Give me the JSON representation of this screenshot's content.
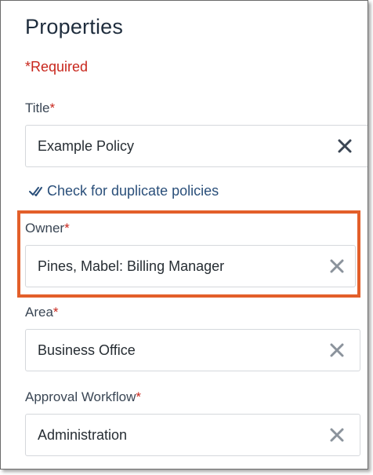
{
  "panel": {
    "title": "Properties",
    "required_note": "*Required"
  },
  "fields": {
    "title": {
      "label": "Title",
      "required_mark": "*",
      "value": "Example Policy",
      "clear_icon": "close-icon"
    },
    "duplicate_check": {
      "label": "Check for duplicate policies",
      "icon": "double-check-icon"
    },
    "owner": {
      "label": "Owner",
      "required_mark": "*",
      "value": "Pines, Mabel: Billing Manager",
      "clear_icon": "close-icon"
    },
    "area": {
      "label": "Area",
      "required_mark": "*",
      "value": "Business Office",
      "clear_icon": "close-icon"
    },
    "approval_workflow": {
      "label": "Approval Workflow",
      "required_mark": "*",
      "value": "Administration",
      "clear_icon": "close-icon"
    }
  },
  "colors": {
    "required_red": "#c8261c",
    "highlight_orange": "#e35f2a",
    "link_blue": "#2a4f7a",
    "clear_icon_dark": "#3b4654",
    "clear_icon_light": "#8b939c"
  }
}
